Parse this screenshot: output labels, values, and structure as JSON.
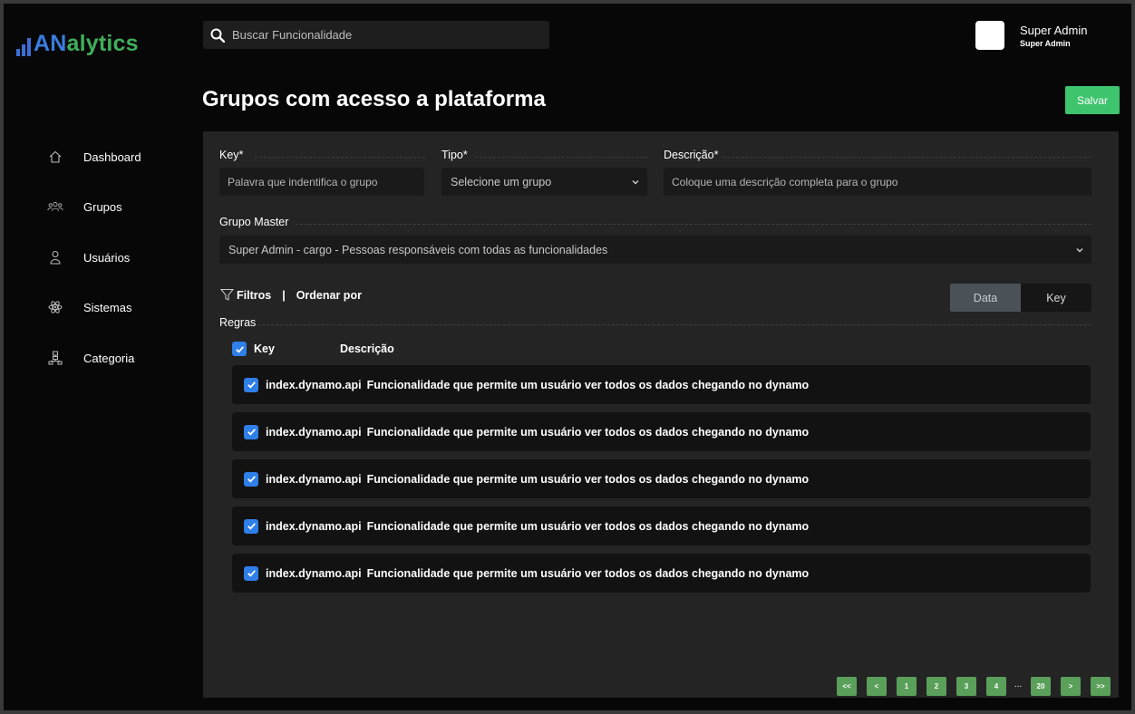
{
  "brand": {
    "logo_text_a": "AN",
    "logo_text_b": "alytics",
    "colors": {
      "blue": "#3b7ce0",
      "green": "#3fae5a"
    }
  },
  "search": {
    "placeholder": "Buscar Funcionalidade",
    "icon": "search-icon"
  },
  "user": {
    "name": "Super Admin",
    "role": "Super Admin"
  },
  "page": {
    "title": "Grupos com acesso a plataforma",
    "save_label": "Salvar",
    "save_color": "#3ec46d"
  },
  "sidebar": {
    "items": [
      {
        "label": "Dashboard",
        "icon": "home-icon"
      },
      {
        "label": "Grupos",
        "icon": "users-icon"
      },
      {
        "label": "Usuários",
        "icon": "user-icon"
      },
      {
        "label": "Sistemas",
        "icon": "atom-icon"
      },
      {
        "label": "Categoria",
        "icon": "hierarchy-icon"
      }
    ]
  },
  "form": {
    "key": {
      "label": "Key*",
      "placeholder": "Palavra que indentifica o grupo"
    },
    "tipo": {
      "label": "Tipo*",
      "value": "Selecione um grupo"
    },
    "descricao": {
      "label": "Descrição*",
      "placeholder": "Coloque uma descrição completa para o grupo"
    },
    "grupo_master": {
      "label": "Grupo Master",
      "value": "Super Admin - cargo - Pessoas responsáveis com todas as funcionalidades"
    }
  },
  "filters": {
    "filtros_label": "Filtros",
    "separator": "|",
    "order_label": "Ordenar por",
    "toggle": {
      "active": "Data",
      "inactive": "Key"
    }
  },
  "rules": {
    "section_label": "Regras",
    "header": {
      "key": "Key",
      "description": "Descrição"
    },
    "rows": [
      {
        "key": "index.dynamo.api",
        "description": "Funcionalidade que permite um usuário ver todos os dados chegando no dynamo",
        "checked": true
      },
      {
        "key": "index.dynamo.api",
        "description": "Funcionalidade que permite um usuário ver todos os dados chegando no dynamo",
        "checked": true
      },
      {
        "key": "index.dynamo.api",
        "description": "Funcionalidade que permite um usuário ver todos os dados chegando no dynamo",
        "checked": true
      },
      {
        "key": "index.dynamo.api",
        "description": "Funcionalidade que permite um usuário ver todos os dados chegando no dynamo",
        "checked": true
      },
      {
        "key": "index.dynamo.api",
        "description": "Funcionalidade que permite um usuário ver todos os dados chegando no dynamo",
        "checked": true
      }
    ]
  },
  "pagination": {
    "first": "<<",
    "prev": "<",
    "pages": [
      "1",
      "2",
      "3",
      "4"
    ],
    "ellipsis": "...",
    "last_page": "20",
    "next": ">",
    "last": ">>",
    "color": "#5aa05a"
  }
}
